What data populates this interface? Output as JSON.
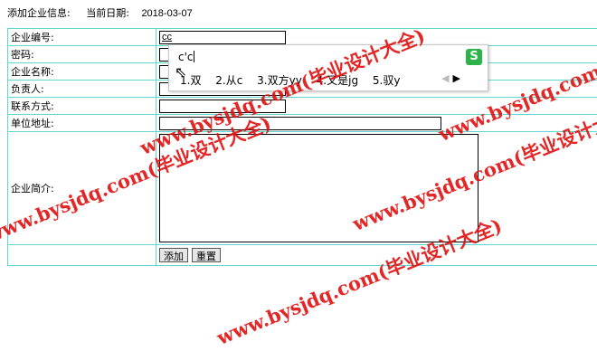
{
  "header": {
    "title": "添加企业信息:",
    "date_label": "当前日期:",
    "date_value": "2018-03-07"
  },
  "form": {
    "labels": {
      "code": "企业编号:",
      "password": "密码:",
      "name": "企业名称:",
      "manager": "负责人:",
      "contact": "联系方式:",
      "address": "单位地址:",
      "intro": "企业简介:"
    },
    "values": {
      "code": "cc",
      "password": "",
      "name": "",
      "manager": "",
      "contact": "",
      "address": "",
      "intro": ""
    },
    "buttons": {
      "add": "添加",
      "reset": "重置"
    }
  },
  "ime": {
    "composition": "c'c",
    "candidates": [
      "1.双",
      "2.从c",
      "3.双方yy",
      "4.又是jg",
      "5.驭y"
    ],
    "logo": "S"
  },
  "watermark": "www.bysjdq.com(毕业设计大全)",
  "colors": {
    "grid_border": "#5fd8d2",
    "watermark": "#e01010",
    "ime_logo": "#2db34a"
  }
}
